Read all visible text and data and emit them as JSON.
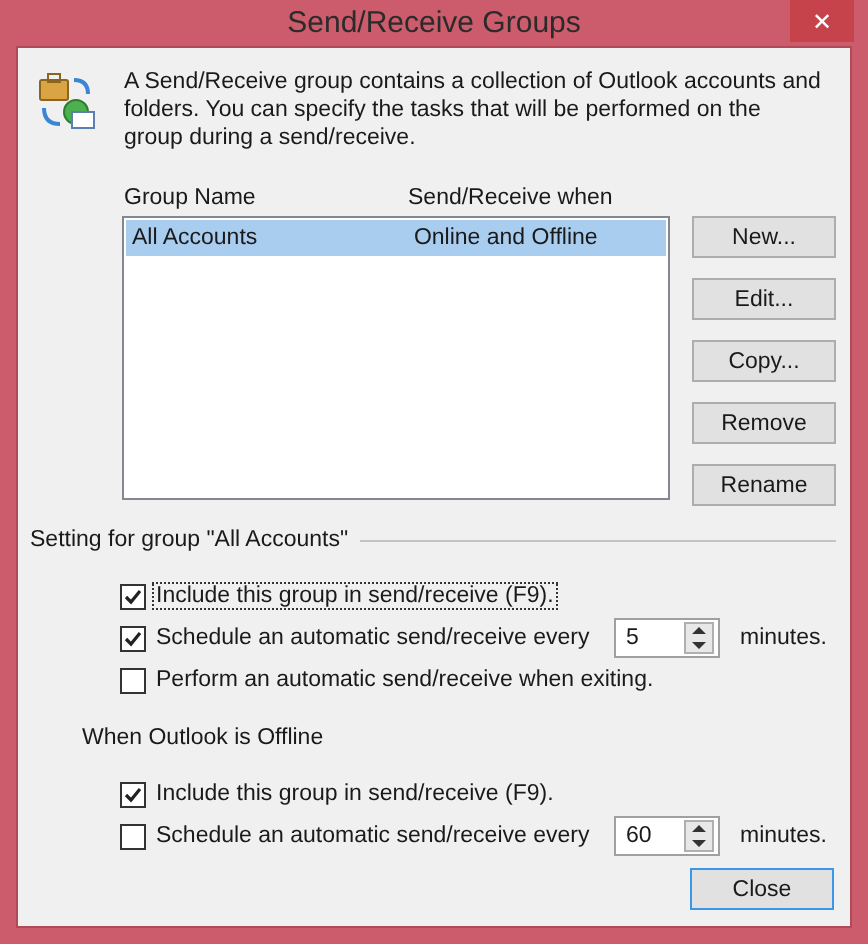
{
  "window": {
    "title": "Send/Receive Groups",
    "close_glyph": "✕"
  },
  "description": "A Send/Receive group contains a collection of Outlook accounts and folders. You can specify the tasks that will be performed on the group during a send/receive.",
  "groups": {
    "columns": [
      "Group Name",
      "Send/Receive when"
    ],
    "rows": [
      {
        "cells": [
          "All Accounts",
          "Online and Offline"
        ],
        "selected": true
      }
    ]
  },
  "group_buttons": [
    "New...",
    "Edit...",
    "Copy...",
    "Remove",
    "Rename"
  ],
  "group_settings": {
    "heading": "Setting for group \"All Accounts\"",
    "options": [
      {
        "kind": "checkbox",
        "label": "Include this group in send/receive (F9).",
        "checked": true,
        "focused": true
      },
      {
        "kind": "schedule",
        "label": "Schedule an automatic send/receive every",
        "checked": true,
        "focused": false,
        "value": "5",
        "unit": "minutes."
      },
      {
        "kind": "checkbox",
        "label": "Perform an automatic send/receive when exiting.",
        "checked": false,
        "focused": false
      }
    ]
  },
  "offline_settings": {
    "heading": "When Outlook is Offline",
    "options": [
      {
        "kind": "checkbox",
        "label": "Include this group in send/receive (F9).",
        "checked": true,
        "focused": false
      },
      {
        "kind": "schedule",
        "label": "Schedule an automatic send/receive every",
        "checked": false,
        "focused": false,
        "value": "60",
        "unit": "minutes."
      }
    ]
  },
  "footer_button": "Close"
}
